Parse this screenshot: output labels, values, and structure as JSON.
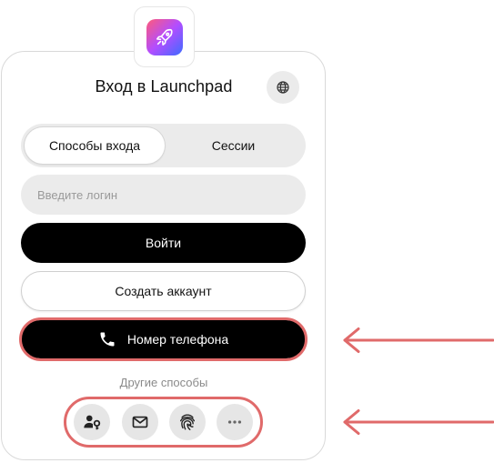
{
  "header": {
    "title": "Вход в Launchpad"
  },
  "tabs": [
    {
      "label": "Способы входа",
      "active": true
    },
    {
      "label": "Сессии",
      "active": false
    }
  ],
  "login": {
    "placeholder": "Введите логин",
    "value": ""
  },
  "buttons": {
    "login_label": "Войти",
    "create_label": "Создать аккаунт",
    "phone_label": "Номер телефона"
  },
  "other_methods": {
    "label": "Другие способы",
    "items": [
      {
        "icon": "user-key-icon"
      },
      {
        "icon": "mail-icon"
      },
      {
        "icon": "fingerprint-icon"
      },
      {
        "icon": "more-dots-icon"
      }
    ]
  },
  "icons": {
    "logo": "rocket-icon",
    "language": "globe-icon",
    "phone": "phone-icon"
  },
  "colors": {
    "primary": "#000000",
    "highlight": "#e06a6a",
    "surface": "#ebebeb",
    "logo_gradient": [
      "#ff5a7a",
      "#b34dff",
      "#3d6bff"
    ]
  }
}
